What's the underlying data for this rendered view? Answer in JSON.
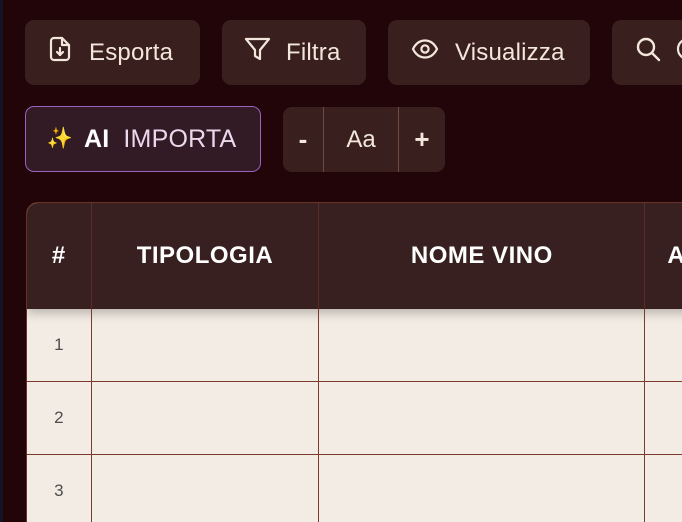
{
  "toolbar": {
    "export_label": "Esporta",
    "filter_label": "Filtra",
    "view_label": "Visualizza",
    "ai_tag": "AI",
    "ai_import_label": "IMPORTA",
    "sparkle_glyph": "✨",
    "font_decrease": "-",
    "font_size_label": "Aa",
    "font_increase": "+",
    "icons": [
      "file-export-icon",
      "filter-icon",
      "eye-icon",
      "search-icon",
      "sparkles-icon"
    ]
  },
  "table": {
    "columns": [
      "#",
      "TIPOLOGIA",
      "NOME VINO",
      "A"
    ],
    "rows": [
      {
        "num": "1",
        "tipologia": "",
        "nome_vino": ""
      },
      {
        "num": "2",
        "tipologia": "",
        "nome_vino": ""
      },
      {
        "num": "3",
        "tipologia": "",
        "nome_vino": ""
      }
    ]
  },
  "colors": {
    "page_background": "#210508",
    "button_background": "#39201e",
    "ai_button_border": "#9a63c0",
    "table_header": "#37201f",
    "table_row": "#f3ece4",
    "grid_line": "#7c3a2c"
  }
}
